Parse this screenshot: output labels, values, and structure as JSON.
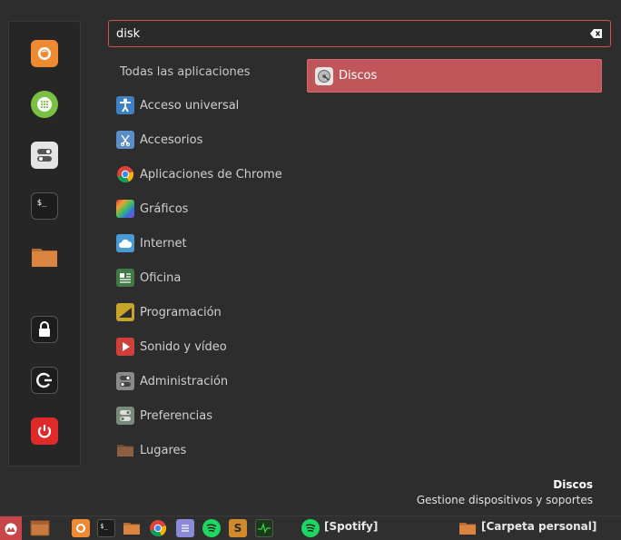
{
  "search": {
    "value": "disk",
    "placeholder": ""
  },
  "favorites": [
    {
      "name": "firefox-icon"
    },
    {
      "name": "software-manager-icon"
    },
    {
      "name": "settings-icon"
    },
    {
      "name": "terminal-icon"
    },
    {
      "name": "folder-icon"
    },
    {
      "name": "lock-icon"
    },
    {
      "name": "logout-icon"
    },
    {
      "name": "power-icon"
    }
  ],
  "categories": {
    "header": "Todas las aplicaciones",
    "items": [
      {
        "label": "Acceso universal"
      },
      {
        "label": "Accesorios"
      },
      {
        "label": "Aplicaciones de Chrome"
      },
      {
        "label": "Gráficos"
      },
      {
        "label": "Internet"
      },
      {
        "label": "Oficina"
      },
      {
        "label": "Programación"
      },
      {
        "label": "Sonido y vídeo"
      },
      {
        "label": "Administración"
      },
      {
        "label": "Preferencias"
      },
      {
        "label": "Lugares"
      }
    ]
  },
  "results": [
    {
      "label": "Discos"
    }
  ],
  "description": {
    "title": "Discos",
    "text": "Gestione dispositivos y soportes"
  },
  "taskbar": {
    "windows": [
      {
        "label": "[Spotify]"
      },
      {
        "label": "[Carpeta personal]"
      }
    ]
  },
  "colors": {
    "accent": "#c0555a",
    "background": "#2d2d2d"
  }
}
